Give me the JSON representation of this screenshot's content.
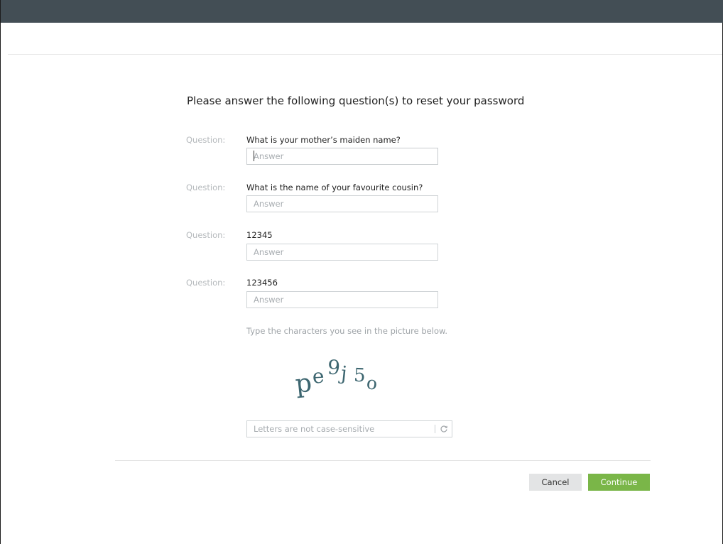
{
  "page": {
    "heading": "Please answer the following question(s) to reset your password"
  },
  "questions": [
    {
      "label": "Question:",
      "text": "What is your mother’s maiden name?",
      "answer_placeholder": "Answer",
      "answer_value": ""
    },
    {
      "label": "Question:",
      "text": "What is the name of your favourite cousin?",
      "answer_placeholder": "Answer",
      "answer_value": ""
    },
    {
      "label": "Question:",
      "text": "12345",
      "answer_placeholder": "Answer",
      "answer_value": ""
    },
    {
      "label": "Question:",
      "text": "123456",
      "answer_placeholder": "Answer",
      "answer_value": ""
    }
  ],
  "captcha": {
    "hint": "Type the characters you see in the picture below.",
    "image_text": "pe9j5o",
    "input_placeholder": "Letters are not case-sensitive",
    "input_value": "",
    "refresh_icon": "refresh-icon"
  },
  "actions": {
    "cancel_label": "Cancel",
    "continue_label": "Continue"
  },
  "colors": {
    "topbar": "#434e55",
    "continue_button": "#7ab648",
    "cancel_button": "#e3e4e5",
    "captcha_ink": "#3d6670"
  }
}
